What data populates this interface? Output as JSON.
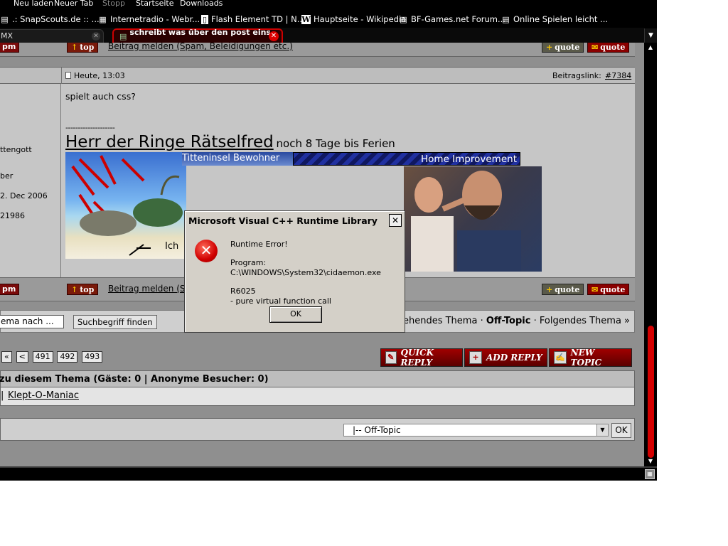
{
  "toolbar": {
    "reload": "Neu laden",
    "newtab": "Neuer Tab",
    "stop": "Stopp",
    "home": "Startseite",
    "downloads": "Downloads"
  },
  "bookmarks": [
    {
      "label": ".: SnapScouts.de :: ...",
      "icon": "cash-icon"
    },
    {
      "label": "Internetradio - Webr...",
      "icon": "radio-icon"
    },
    {
      "label": "Flash Element TD | N...",
      "icon": "page-icon"
    },
    {
      "label": "Hauptseite - Wikipedia",
      "icon": "wikipedia-icon"
    },
    {
      "label": "BF-Games.net Forum...",
      "icon": "cash-icon"
    },
    {
      "label": "Online Spielen leicht ...",
      "icon": "cash-icon"
    }
  ],
  "tabs": [
    {
      "label": "MX"
    },
    {
      "label": "schreibt was über den post eins ..."
    }
  ],
  "top_bar": {
    "pm": "pm",
    "top": "top",
    "report": "Beitrag melden (Spam, Beleidigungen etc.)",
    "quote1": "quote",
    "quote2": "quote"
  },
  "post": {
    "date": "Heute, 13:03",
    "link_label": "Beitragslink:",
    "link_number": "#7384",
    "text": "spielt auch css?",
    "separator": "--------------------",
    "sig_big": "Herr der Ringe Rätselfred",
    "sig_small": "noch 8 Tage bis Ferien",
    "sig_left_banner": "Titteninsel Bewohner",
    "sig_right_banner": "Home Improvement",
    "sig_ich": "Ich"
  },
  "user": {
    "rank": "ttengott",
    "type": "ber",
    "joined": "2. Dec 2006",
    "posts": "21986"
  },
  "bottom_bar": {
    "pm": "pm",
    "top": "top",
    "report": "Beitrag melden (Spam, Beleidigungen etc.)",
    "quote1": "quote",
    "quote2": "quote"
  },
  "search": {
    "value": "ema nach ...",
    "button": "Suchbegriff finden"
  },
  "thread_nav": {
    "prev": "« Vorhergehendes Thema",
    "sep1": "·",
    "current": "Off-Topic",
    "sep2": "·",
    "next": "Folgendes Thema »"
  },
  "pager": {
    "first": "«",
    "prev": "<",
    "pages": [
      "491",
      "492",
      "493"
    ]
  },
  "actions": {
    "quick_reply": "Quick Reply",
    "add_reply": "Add Reply",
    "new_topic": "New Topic"
  },
  "online": {
    "header": "zu diesem Thema (Gäste: 0 | Anonyme Besucher: 0)",
    "sep": "|",
    "user": "Klept-O-Maniac"
  },
  "jump": {
    "selected": "|-- Off-Topic",
    "ok": "OK"
  },
  "dialog": {
    "title": "Microsoft Visual C++ Runtime Library",
    "close": "✕",
    "line1": "Runtime Error!",
    "line2": "Program: C:\\WINDOWS\\System32\\cidaemon.exe",
    "line3": "R6025",
    "line4": "- pure virtual function call",
    "ok": "OK"
  },
  "scroll": {
    "position_fraction": 0.7
  }
}
